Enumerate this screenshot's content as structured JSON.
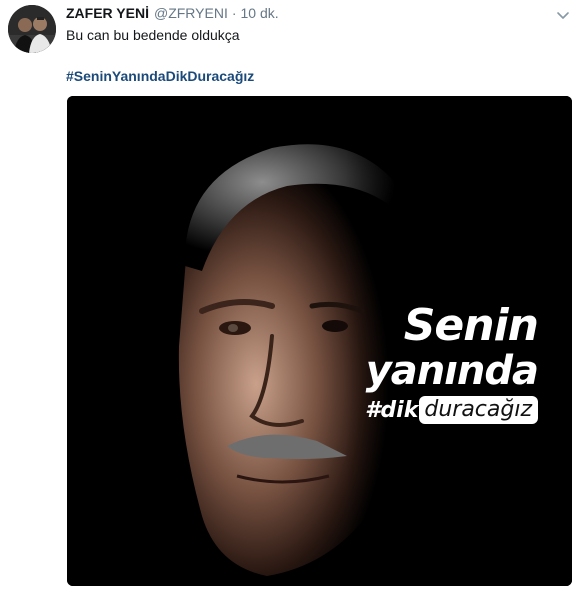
{
  "user": {
    "display_name": "ZAFER YENİ",
    "handle": "@ZFRYENI",
    "separator": "·",
    "time": "10 dk."
  },
  "tweet": {
    "text": "Bu can bu bedende oldukça",
    "hashtag": "#SeninYanındaDikDuracağız"
  },
  "media": {
    "line1": "Senin",
    "line2": "yanında",
    "tag_prefix": "#dik",
    "tag_pill": "duracağız"
  },
  "icons": {
    "caret": "chevron-down-icon"
  },
  "colors": {
    "name": "#14171a",
    "secondary": "#657786",
    "hashtag": "#1b4a7a",
    "media_bg": "#000000"
  }
}
